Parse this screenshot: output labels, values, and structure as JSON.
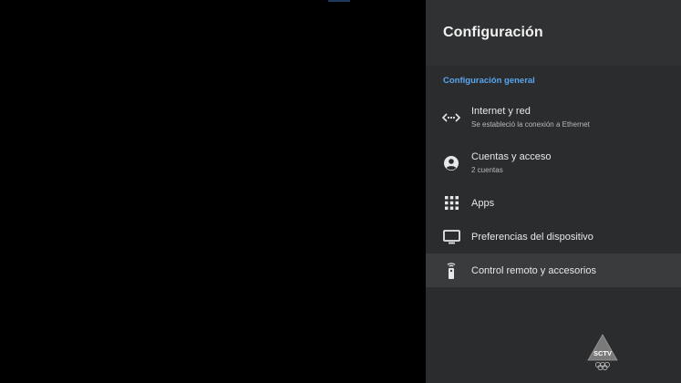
{
  "panel": {
    "title": "Configuración",
    "section_label": "Configuración general"
  },
  "items": [
    {
      "label": "Internet y red",
      "sub": "Se estableció la conexión a Ethernet",
      "icon": "network-icon"
    },
    {
      "label": "Cuentas y acceso",
      "sub": "2 cuentas",
      "icon": "account-icon"
    },
    {
      "label": "Apps",
      "icon": "apps-grid-icon"
    },
    {
      "label": "Preferencias del dispositivo",
      "icon": "tv-icon"
    },
    {
      "label": "Control remoto y accesorios",
      "icon": "remote-icon",
      "selected": true
    }
  ],
  "watermark": {
    "text": "SCTV"
  },
  "colors": {
    "panel_bg": "#2b2c2e",
    "header_bg": "#303133",
    "accent": "#5aa5f0",
    "selected_bg": "#3a3b3d"
  }
}
